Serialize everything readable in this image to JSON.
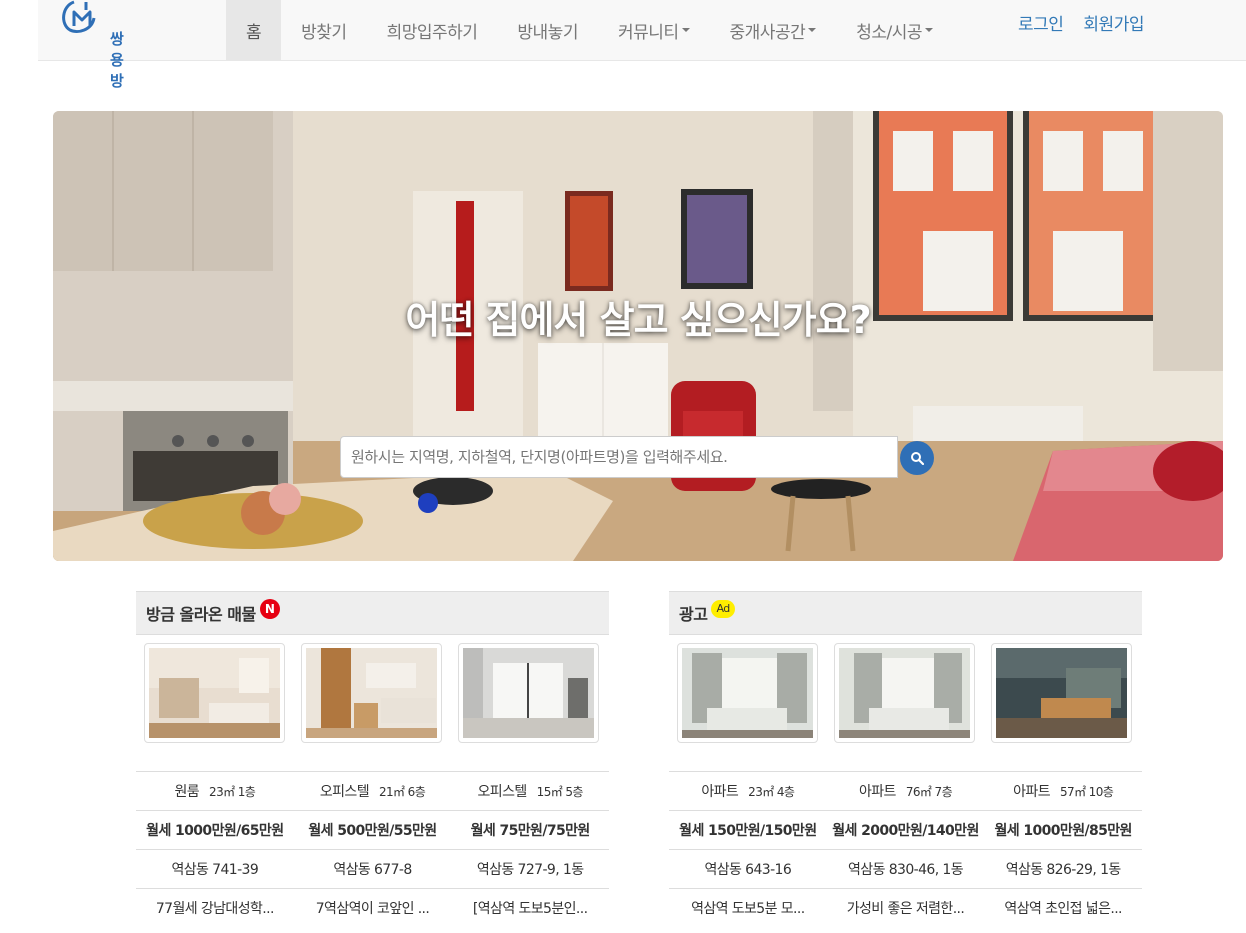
{
  "brand": {
    "name": "쌍용방"
  },
  "nav": {
    "items": [
      {
        "label": "홈",
        "active": true,
        "dropdown": false
      },
      {
        "label": "방찾기",
        "active": false,
        "dropdown": false
      },
      {
        "label": "희망입주하기",
        "active": false,
        "dropdown": false
      },
      {
        "label": "방내놓기",
        "active": false,
        "dropdown": false
      },
      {
        "label": "커뮤니티",
        "active": false,
        "dropdown": true
      },
      {
        "label": "중개사공간",
        "active": false,
        "dropdown": true
      },
      {
        "label": "청소/시공",
        "active": false,
        "dropdown": true
      }
    ],
    "login": "로그인",
    "signup": "회원가입"
  },
  "hero": {
    "title": "어떤 집에서 살고 싶으신가요?",
    "search_placeholder": "원하시는 지역명, 지하철역, 단지명(아파트명)을 입력해주세요."
  },
  "recent": {
    "title": "방금 올라온 매물",
    "badge": "N",
    "listings": [
      {
        "type": "원룸",
        "detail": "23㎡ 1층",
        "price": "월세 1000만원/65만원",
        "address": "역삼동 741-39",
        "desc": "77월세 강남대성학..."
      },
      {
        "type": "오피스텔",
        "detail": "21㎡ 6층",
        "price": "월세 500만원/55만원",
        "address": "역삼동 677-8",
        "desc": "7역삼역이 코앞인 ..."
      },
      {
        "type": "오피스텔",
        "detail": "15㎡ 5층",
        "price": "월세 75만원/75만원",
        "address": "역삼동 727-9, 1동",
        "desc": "[역삼역 도보5분인..."
      }
    ]
  },
  "ads": {
    "title": "광고",
    "badge": "Ad",
    "listings": [
      {
        "type": "아파트",
        "detail": "23㎡ 4층",
        "price": "월세 150만원/150만원",
        "address": "역삼동 643-16",
        "desc": "역삼역 도보5분 모..."
      },
      {
        "type": "아파트",
        "detail": "76㎡ 7층",
        "price": "월세 2000만원/140만원",
        "address": "역삼동 830-46, 1동",
        "desc": "가성비 좋은 저렴한..."
      },
      {
        "type": "아파트",
        "detail": "57㎡ 10층",
        "price": "월세 1000만원/85만원",
        "address": "역삼동 826-29, 1동",
        "desc": "역삼역 초인접 넓은..."
      }
    ]
  },
  "colors": {
    "accent": "#2f6fb6",
    "new_badge": "#e60012",
    "ad_badge": "#ffee00",
    "link": "#337ab7"
  }
}
